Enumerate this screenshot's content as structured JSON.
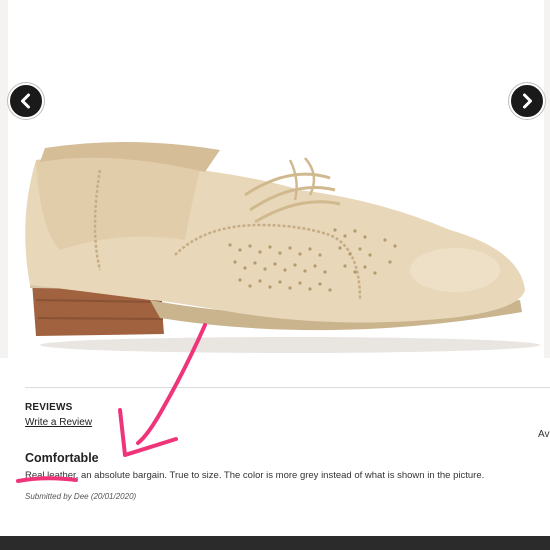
{
  "gallery": {
    "prev_icon": "chevron-left-icon",
    "next_icon": "chevron-right-icon"
  },
  "reviews": {
    "heading": "REVIEWS",
    "write_link": "Write a Review",
    "avg_label": "Av",
    "items": [
      {
        "title": "Comfortable",
        "body": "Real leather, an absolute bargain. True to size. The color is more grey instead of what is shown in the picture.",
        "submitted_by": "Submitted by Dee (20/01/2020)"
      }
    ]
  },
  "colors": {
    "annotation": "#f0347a",
    "shoe_leather": "#e8d7b8",
    "heel": "#a0623f"
  }
}
